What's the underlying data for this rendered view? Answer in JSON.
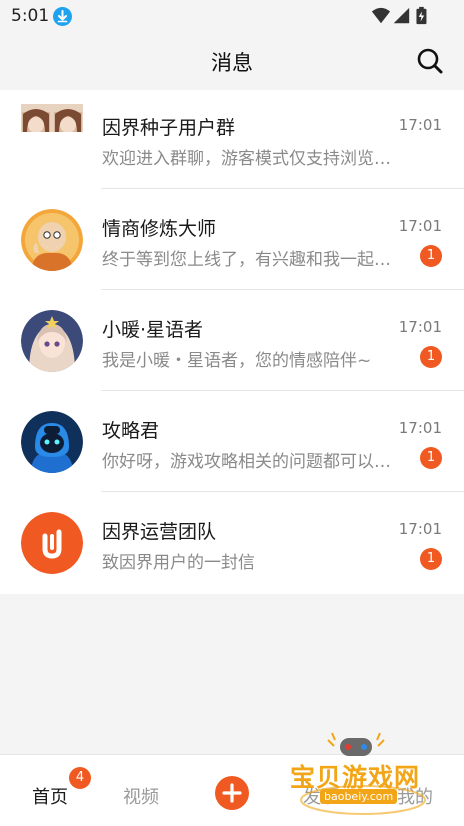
{
  "status_bar": {
    "time": "5:01"
  },
  "header": {
    "title": "消息"
  },
  "conversations": [
    {
      "name": "因界种子用户群",
      "time": "17:01",
      "message": "欢迎进入群聊，游客模式仅支持浏览消息",
      "badge": ""
    },
    {
      "name": "情商修炼大师",
      "time": "17:01",
      "message": "终于等到您上线了，有兴趣和我一起…",
      "badge": "1"
    },
    {
      "name": "小暖·星语者",
      "time": "17:01",
      "message": "我是小暖・星语者，您的情感陪伴~",
      "badge": "1"
    },
    {
      "name": "攻略君",
      "time": "17:01",
      "message": "你好呀，游戏攻略相关的问题都可以…",
      "badge": "1"
    },
    {
      "name": "因界运营团队",
      "time": "17:01",
      "message": "致因界用户的一封信",
      "badge": "1"
    }
  ],
  "tab_bar": {
    "home": "首页",
    "home_badge": "4",
    "video": "视频",
    "discover": "发现",
    "mine": "我的"
  },
  "watermark": {
    "text": "宝贝游戏网",
    "url": "baobeiy.com"
  },
  "colors": {
    "accent": "#f05a22",
    "background": "#f4f4f4",
    "list_background": "#ffffff"
  },
  "icons": {
    "download": "download-icon",
    "search": "search-icon",
    "wifi": "wifi-icon",
    "signal": "signal-icon",
    "battery": "battery-icon",
    "add": "plus-icon"
  }
}
